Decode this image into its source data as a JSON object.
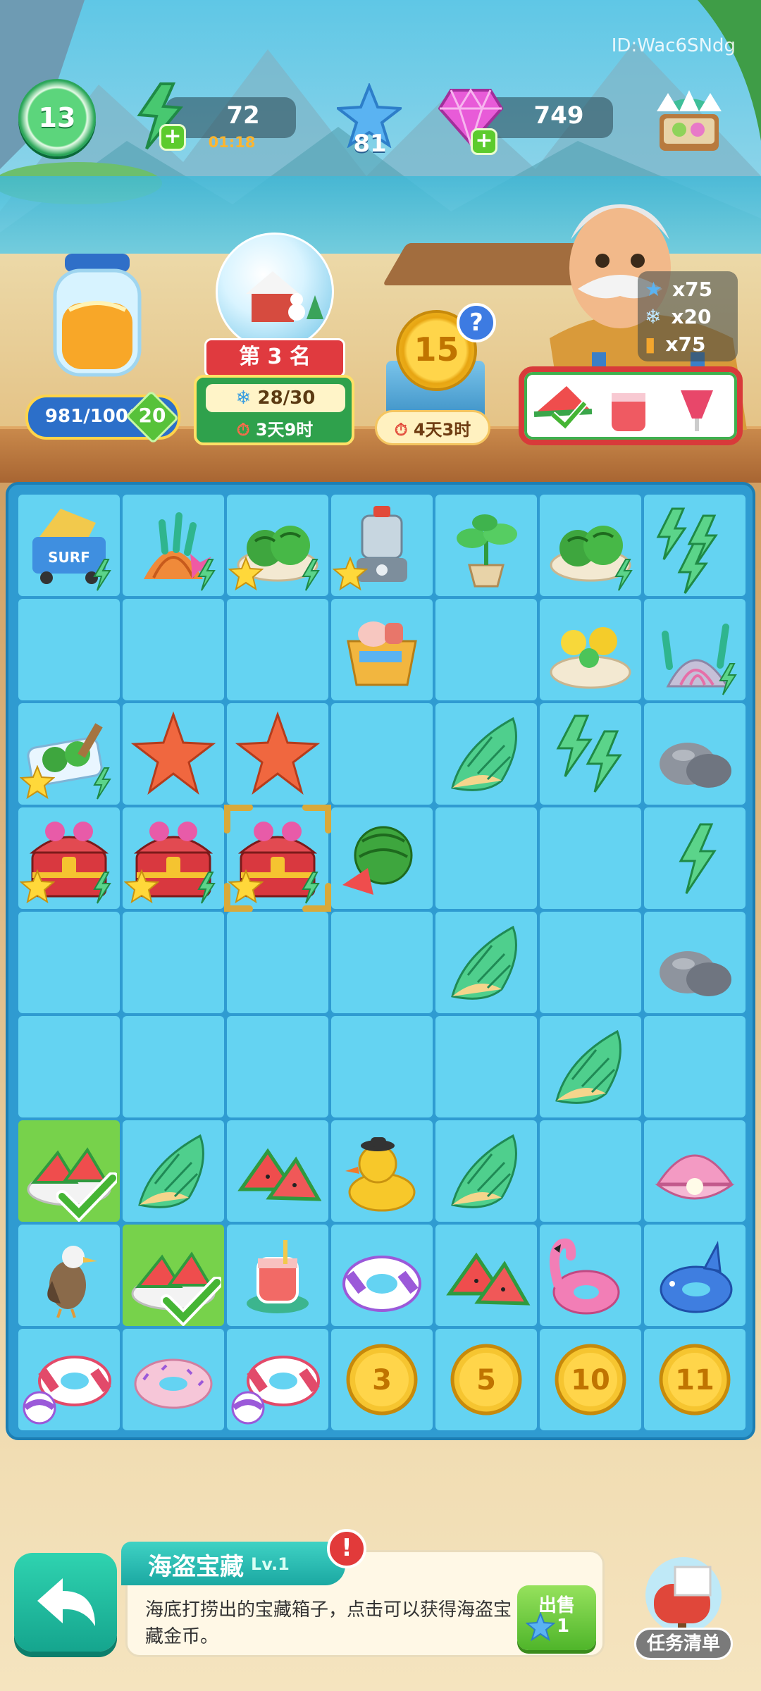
{
  "hud": {
    "user_id": "ID:Wac6SNdg",
    "level": "13",
    "energy": "72",
    "energy_timer": "01:18",
    "stars": "81",
    "gems": "749"
  },
  "events": {
    "jar_progress": "981/1000",
    "jar_badge": "20",
    "rank_label": "第 3 名",
    "rank_progress": "28/30",
    "rank_timer": "3天9时",
    "coin_value": "15",
    "coin_timer": "4天3时"
  },
  "requirements": [
    {
      "icon": "star-icon",
      "value": "x75"
    },
    {
      "icon": "snowflake-icon",
      "value": "x20"
    },
    {
      "icon": "juice-icon",
      "value": "x75"
    }
  ],
  "board": {
    "rows": [
      [
        "surf-cart",
        "coral-shell",
        "watermelon-plate",
        "blender",
        "potted-plant",
        "watermelon-plate",
        "triple-bolt"
      ],
      [
        "",
        "",
        "",
        "basket",
        "",
        "flower-plate",
        "coral-shell-pink"
      ],
      [
        "watermelon-cart",
        "starfish",
        "starfish",
        "",
        "conch",
        "double-bolt",
        "rock"
      ],
      [
        "treasure-chest",
        "treasure-chest",
        "treasure-chest",
        "watermelon",
        "",
        "",
        "bolt"
      ],
      [
        "",
        "",
        "",
        "",
        "conch",
        "",
        "rock"
      ],
      [
        "",
        "",
        "",
        "",
        "",
        "conch",
        ""
      ],
      [
        "watermelon-slices-plate",
        "conch",
        "watermelon-slices",
        "rubber-duck",
        "conch",
        "",
        "pearl-clam"
      ],
      [
        "seagull",
        "watermelon-slices-plate",
        "juice-cup",
        "swim-ring-purple",
        "watermelon-slices",
        "flamingo-float",
        "shark-float"
      ],
      [
        "swim-ring-ball",
        "donut-float",
        "swim-ring-ball",
        "coin",
        "coin",
        "coin",
        "coin"
      ]
    ],
    "coin_values": [
      "3",
      "5",
      "10",
      "11"
    ],
    "selected_cell": "3-2"
  },
  "info": {
    "title": "海盗宝藏",
    "level": "Lv.1",
    "description": "海底打捞出的宝藏箱子，点击可以获得海盗宝藏金币。",
    "sell_label": "出售",
    "sell_price": "1"
  },
  "tasks_label": "任务清单"
}
